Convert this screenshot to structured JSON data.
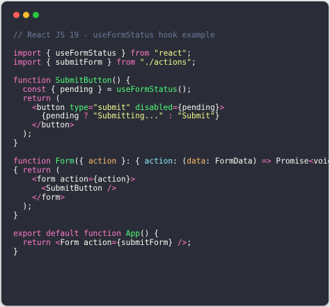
{
  "window": {
    "controls": [
      {
        "name": "close-button",
        "color": "#ff5f57"
      },
      {
        "name": "minimize-button",
        "color": "#febc2e"
      },
      {
        "name": "zoom-button",
        "color": "#28c840"
      }
    ]
  },
  "code": {
    "lines": [
      [
        {
          "t": "// React JS 19 - useFormStatus hook example",
          "k": "comment"
        }
      ],
      [],
      [
        {
          "t": "import",
          "k": "keyword"
        },
        {
          "t": " { ",
          "k": "plain"
        },
        {
          "t": "useFormStatus",
          "k": "plain"
        },
        {
          "t": " } ",
          "k": "plain"
        },
        {
          "t": "from",
          "k": "keyword"
        },
        {
          "t": " ",
          "k": "plain"
        },
        {
          "t": "\"react\"",
          "k": "string"
        },
        {
          "t": ";",
          "k": "plain"
        }
      ],
      [
        {
          "t": "import",
          "k": "keyword"
        },
        {
          "t": " { ",
          "k": "plain"
        },
        {
          "t": "submitForm",
          "k": "plain"
        },
        {
          "t": " } ",
          "k": "plain"
        },
        {
          "t": "from",
          "k": "keyword"
        },
        {
          "t": " ",
          "k": "plain"
        },
        {
          "t": "\"./actions\"",
          "k": "string"
        },
        {
          "t": ";",
          "k": "plain"
        }
      ],
      [],
      [
        {
          "t": "function",
          "k": "keyword"
        },
        {
          "t": " ",
          "k": "plain"
        },
        {
          "t": "SubmitButton",
          "k": "func"
        },
        {
          "t": "() {",
          "k": "plain"
        }
      ],
      [
        {
          "t": "  ",
          "k": "plain"
        },
        {
          "t": "const",
          "k": "keyword"
        },
        {
          "t": " { ",
          "k": "plain"
        },
        {
          "t": "pending",
          "k": "plain"
        },
        {
          "t": " } = ",
          "k": "plain"
        },
        {
          "t": "useFormStatus",
          "k": "func"
        },
        {
          "t": "();",
          "k": "plain"
        }
      ],
      [
        {
          "t": "  ",
          "k": "plain"
        },
        {
          "t": "return",
          "k": "keyword"
        },
        {
          "t": " (",
          "k": "plain"
        }
      ],
      [
        {
          "t": "    ",
          "k": "plain"
        },
        {
          "t": "<",
          "k": "tag"
        },
        {
          "t": "button",
          "k": "plain"
        },
        {
          "t": " ",
          "k": "plain"
        },
        {
          "t": "type",
          "k": "attr"
        },
        {
          "t": "=",
          "k": "keyword"
        },
        {
          "t": "\"submit\"",
          "k": "string"
        },
        {
          "t": " ",
          "k": "plain"
        },
        {
          "t": "disabled",
          "k": "attr"
        },
        {
          "t": "=",
          "k": "keyword"
        },
        {
          "t": "{pending}",
          "k": "plain"
        },
        {
          "t": ">",
          "k": "tag"
        }
      ],
      [
        {
          "t": "      {",
          "k": "plain"
        },
        {
          "t": "pending",
          "k": "plain"
        },
        {
          "t": " ? ",
          "k": "keyword"
        },
        {
          "t": "\"Submitting...\"",
          "k": "string"
        },
        {
          "t": " : ",
          "k": "keyword"
        },
        {
          "t": "\"Submit\"",
          "k": "string"
        },
        {
          "t": "}",
          "k": "plain"
        }
      ],
      [
        {
          "t": "    ",
          "k": "plain"
        },
        {
          "t": "</",
          "k": "tag"
        },
        {
          "t": "button",
          "k": "plain"
        },
        {
          "t": ">",
          "k": "tag"
        }
      ],
      [
        {
          "t": "  );",
          "k": "plain"
        }
      ],
      [
        {
          "t": "}",
          "k": "plain"
        }
      ],
      [],
      [
        {
          "t": "function",
          "k": "keyword"
        },
        {
          "t": " ",
          "k": "plain"
        },
        {
          "t": "Form",
          "k": "func"
        },
        {
          "t": "({ ",
          "k": "plain"
        },
        {
          "t": "action",
          "k": "param"
        },
        {
          "t": " }: { ",
          "k": "plain"
        },
        {
          "t": "action",
          "k": "type"
        },
        {
          "t": ": (",
          "k": "plain"
        },
        {
          "t": "data",
          "k": "param"
        },
        {
          "t": ": ",
          "k": "plain"
        },
        {
          "t": "FormData",
          "k": "plain"
        },
        {
          "t": ") ",
          "k": "plain"
        },
        {
          "t": "=>",
          "k": "keyword"
        },
        {
          "t": " ",
          "k": "plain"
        },
        {
          "t": "Promise",
          "k": "plain"
        },
        {
          "t": "<",
          "k": "keyword"
        },
        {
          "t": "void",
          "k": "plain"
        },
        {
          "t": ">",
          "k": "keyword"
        },
        {
          "t": " })",
          "k": "plain"
        }
      ],
      [
        {
          "t": "{ ",
          "k": "plain"
        },
        {
          "t": "return",
          "k": "keyword"
        },
        {
          "t": " (",
          "k": "plain"
        }
      ],
      [
        {
          "t": "    ",
          "k": "plain"
        },
        {
          "t": "<",
          "k": "tag"
        },
        {
          "t": "form",
          "k": "plain"
        },
        {
          "t": " ",
          "k": "plain"
        },
        {
          "t": "action",
          "k": "plain"
        },
        {
          "t": "=",
          "k": "keyword"
        },
        {
          "t": "{action}",
          "k": "plain"
        },
        {
          "t": ">",
          "k": "tag"
        }
      ],
      [
        {
          "t": "      ",
          "k": "plain"
        },
        {
          "t": "<",
          "k": "tag"
        },
        {
          "t": "SubmitButton",
          "k": "plain"
        },
        {
          "t": " ",
          "k": "plain"
        },
        {
          "t": "/>",
          "k": "tag"
        }
      ],
      [
        {
          "t": "    ",
          "k": "plain"
        },
        {
          "t": "</",
          "k": "tag"
        },
        {
          "t": "form",
          "k": "plain"
        },
        {
          "t": ">",
          "k": "tag"
        }
      ],
      [
        {
          "t": "  );",
          "k": "plain"
        }
      ],
      [
        {
          "t": "}",
          "k": "plain"
        }
      ],
      [],
      [
        {
          "t": "export",
          "k": "keyword"
        },
        {
          "t": " ",
          "k": "plain"
        },
        {
          "t": "default",
          "k": "keyword"
        },
        {
          "t": " ",
          "k": "plain"
        },
        {
          "t": "function",
          "k": "keyword"
        },
        {
          "t": " ",
          "k": "plain"
        },
        {
          "t": "App",
          "k": "func"
        },
        {
          "t": "() {",
          "k": "plain"
        }
      ],
      [
        {
          "t": "  ",
          "k": "plain"
        },
        {
          "t": "return",
          "k": "keyword"
        },
        {
          "t": " ",
          "k": "plain"
        },
        {
          "t": "<",
          "k": "tag"
        },
        {
          "t": "Form",
          "k": "plain"
        },
        {
          "t": " ",
          "k": "plain"
        },
        {
          "t": "action",
          "k": "plain"
        },
        {
          "t": "=",
          "k": "keyword"
        },
        {
          "t": "{submitForm}",
          "k": "plain"
        },
        {
          "t": " ",
          "k": "plain"
        },
        {
          "t": "/>",
          "k": "tag"
        },
        {
          "t": ";",
          "k": "plain"
        }
      ],
      [
        {
          "t": "}",
          "k": "plain"
        }
      ]
    ]
  }
}
